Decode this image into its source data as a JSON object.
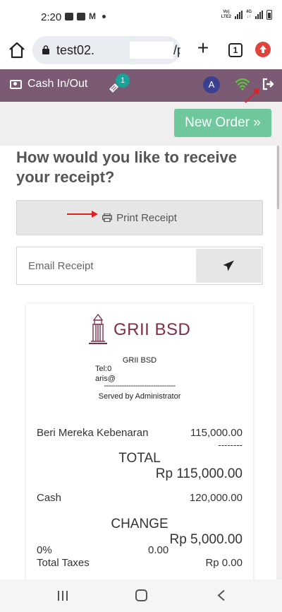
{
  "status_bar": {
    "time": "2:20",
    "m_glyph": "M",
    "net_line1": "Vo)",
    "net_line2": "LTE2",
    "net4g_line1": "4G",
    "net4g_line2": "↓↑"
  },
  "browser": {
    "url_prefix": "test02.",
    "url_suffix": "/pos/u",
    "tab_count": "1"
  },
  "pos_header": {
    "cash_label": "Cash In/Out",
    "ticket_badge": "1",
    "avatar_initial": "A"
  },
  "actions": {
    "new_order_label": "New Order »"
  },
  "receipt_prompt": {
    "question": "How would you like to receive your receipt?",
    "print_label": "Print Receipt",
    "email_placeholder": "Email Receipt"
  },
  "receipt": {
    "logo_text": "GRII BSD",
    "company_name": "GRII BSD",
    "tel_label": "Tel:0",
    "email_prefix": "aris@",
    "separator": "--------------------------------",
    "served_by": "Served by Administrator",
    "lines": [
      {
        "name": "Beri Mereka Kebenaran",
        "price": "115,000.00"
      }
    ],
    "line_separator": "--------",
    "total_label": "TOTAL",
    "total_amount": "Rp 115,000.00",
    "payment_label": "Cash",
    "payment_amount": "120,000.00",
    "change_label": "CHANGE",
    "change_amount": "Rp 5,000.00",
    "tax_rate": "0%",
    "tax_amount": "0.00",
    "total_taxes_label": "Total Taxes",
    "total_taxes_amount": "Rp 0.00"
  },
  "colors": {
    "header_bg": "#7b5b73",
    "new_order_bg": "#6ec89b",
    "badge_bg": "#18a39b",
    "avatar_bg": "#3a3f8f",
    "wifi_green": "#5cc63f",
    "logo_color": "#7e2e4a",
    "annotation_red": "#e02020"
  }
}
